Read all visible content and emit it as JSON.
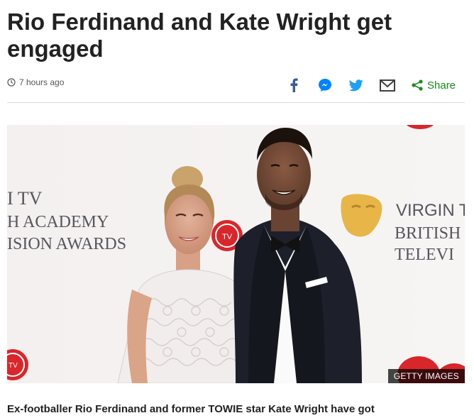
{
  "article": {
    "headline": "Rio Ferdinand and Kate Wright get engaged",
    "timestamp": "7 hours ago",
    "image_credit": "GETTY IMAGES",
    "standfirst": "Ex-footballer Rio Ferdinand and former TOWIE star Kate Wright have got"
  },
  "share_bar": {
    "share_label": "Share",
    "icons": [
      "facebook-icon",
      "messenger-icon",
      "twitter-icon",
      "email-icon",
      "share-icon"
    ]
  },
  "backdrop_text": {
    "left_line1": "I TV",
    "left_line2": "H ACADEMY",
    "left_line3": "ISION AWARDS",
    "right_line1": "VIRGIN T",
    "right_line2": "BRITISH",
    "right_line3": "TELEVI",
    "tv_badge": "TV"
  },
  "colors": {
    "text": "#222222",
    "muted": "#555555",
    "facebook": "#3b5998",
    "messenger": "#0084ff",
    "twitter": "#1da1f2",
    "email": "#404040",
    "share": "#1d8a1d",
    "tv_red": "#d8262b"
  }
}
